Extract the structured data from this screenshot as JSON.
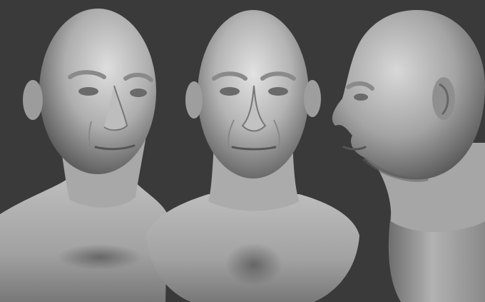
{
  "scene": {
    "background_color": "#3a3a3a",
    "clay_light": "#dcdcdc",
    "clay_mid": "#9a9a9a",
    "clay_dark": "#4c4c4c",
    "views": [
      {
        "name": "three-quarter-view"
      },
      {
        "name": "front-view"
      },
      {
        "name": "profile-view"
      }
    ]
  }
}
